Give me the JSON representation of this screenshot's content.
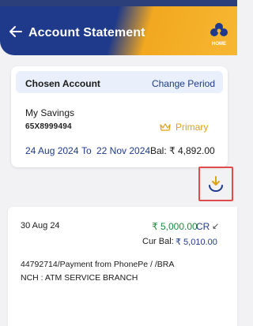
{
  "header": {
    "title": "Account Statement",
    "home_label": "HOME",
    "back_icon": "arrow-left-icon",
    "home_icon": "home-logo-icon"
  },
  "account": {
    "chosen_label": "Chosen Account",
    "change_period_label": "Change Period",
    "name": "My Savings",
    "number": "65X8999494",
    "primary_label": "Primary",
    "period_from": "24 Aug 2024",
    "period_to_word": "To",
    "period_to": "22 Nov 2024",
    "balance": "Bal: ₹ 4,892.00"
  },
  "download": {
    "icon": "download-icon",
    "accent_color": "#e0a014"
  },
  "transaction": {
    "date": "30 Aug 24",
    "amount": "₹ 5,000.00",
    "type": "CR",
    "direction_icon": "↙",
    "current_balance_label": "Cur Bal:",
    "current_balance": "₹ 5,010.00",
    "description_line1": "44792714/Payment from PhonePe / /BRA",
    "description_line2": "NCH : ATM SERVICE BRANCH"
  },
  "colors": {
    "brand_blue": "#1f3a8a",
    "brand_gold": "#f2a81f",
    "credit_green": "#1e8a3c",
    "highlight_red": "#e04b4b"
  }
}
